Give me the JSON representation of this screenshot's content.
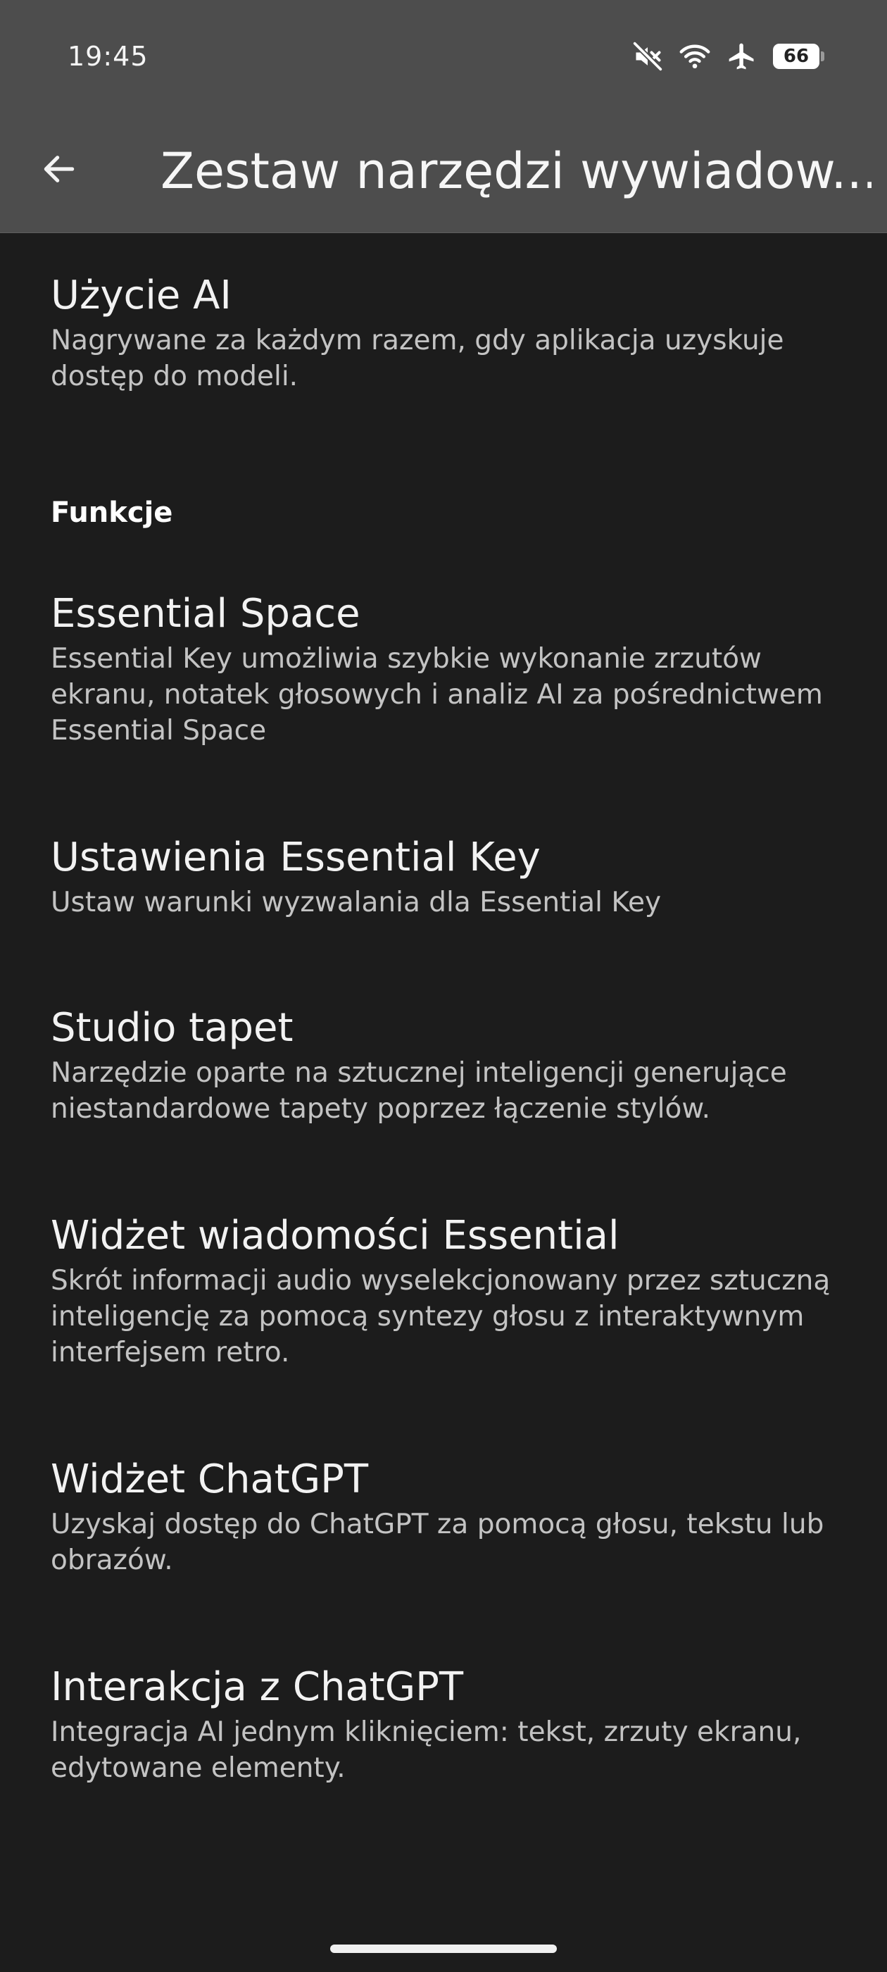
{
  "status_bar": {
    "time": "19:45",
    "icons": [
      "mute-icon",
      "wifi-icon",
      "airplane-icon",
      "battery-icon"
    ],
    "battery_level": "66"
  },
  "header": {
    "back_icon": "arrow-left-icon",
    "title": "Zestaw narzędzi wywiadow..."
  },
  "items": [
    {
      "title": "Użycie AI",
      "summary": "Nagrywane za każdym razem, gdy aplikacja uzyskuje dostęp do modeli."
    },
    {
      "title": "Essential Space",
      "summary": "Essential Key umożliwia szybkie wykonanie zrzutów ekranu, notatek głosowych i analiz AI za pośrednictwem Essential Space"
    },
    {
      "title": "Ustawienia Essential Key",
      "summary": "Ustaw warunki wyzwalania dla Essential Key"
    },
    {
      "title": "Studio tapet",
      "summary": "Narzędzie oparte na sztucznej inteligencji generujące niestandardowe tapety poprzez łączenie stylów."
    },
    {
      "title": "Widżet wiadomości Essential",
      "summary": "Skrót informacji audio wyselekcjonowany przez sztuczną inteligencję za pomocą syntezy głosu z interaktywnym interfejsem retro."
    },
    {
      "title": "Widżet ChatGPT",
      "summary": "Uzyskaj dostęp do ChatGPT za pomocą głosu, tekstu lub obrazów."
    },
    {
      "title": "Interakcja z ChatGPT",
      "summary": "Integracja AI jednym kliknięciem: tekst, zrzuty ekranu, edytowane elementy."
    }
  ],
  "sections": {
    "features_header": "Funkcje"
  },
  "colors": {
    "background": "#1c1c1c",
    "toolbar": "#4d4d4d",
    "title_text": "#f2f2f2",
    "summary_text": "#c3c3c3"
  }
}
